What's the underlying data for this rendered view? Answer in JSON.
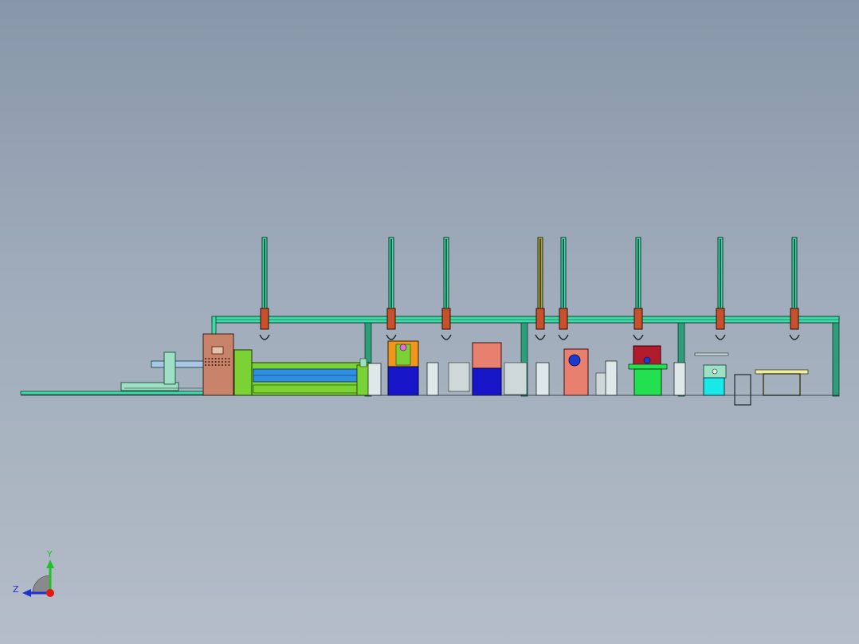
{
  "viewport": {
    "background_top": "#8797a9",
    "background_bottom": "#b4bdc8"
  },
  "colors": {
    "gantry": "#3fdcaa",
    "gantry_outline": "#0d3b2c",
    "gripper": "#c8502c",
    "cabinet": "#c9836b",
    "green_module": "#7ad234",
    "blue_bed": "#2f8fe0",
    "dark_blue": "#1616c8",
    "orange": "#f0961c",
    "salmon": "#e88070",
    "bright_green": "#22e050",
    "dark_red": "#b01c2c",
    "cyan": "#18e8e8",
    "pale_yellow": "#f0eca8"
  },
  "triad": {
    "y_label": "Y",
    "z_label": "Z",
    "y_color": "#22c02a",
    "z_color": "#2030d0",
    "origin_color": "#e01818"
  }
}
